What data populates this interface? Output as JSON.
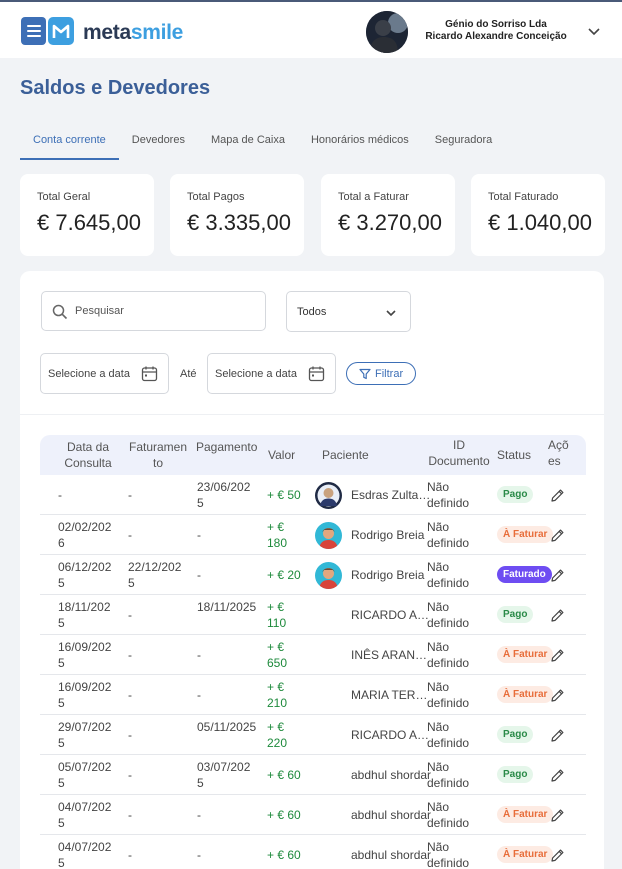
{
  "app": {
    "brand_a": "meta",
    "brand_b": "smile",
    "brand_color": "#3d6fb6",
    "accent_color": "#3d9fe0"
  },
  "user": {
    "company": "Génio do Sorriso Lda",
    "name": "Ricardo Alexandre Conceição",
    "avatar_icon": "user-avatar"
  },
  "page": {
    "title": "Saldos e Devedores"
  },
  "tabs": [
    {
      "label": "Conta corrente",
      "active": true
    },
    {
      "label": "Devedores",
      "active": false
    },
    {
      "label": "Mapa de Caixa",
      "active": false
    },
    {
      "label": "Honorários médicos",
      "active": false
    },
    {
      "label": "Seguradora",
      "active": false
    }
  ],
  "stats": [
    {
      "label": "Total Geral",
      "value": "€ 7.645,00"
    },
    {
      "label": "Total Pagos",
      "value": "€ 3.335,00"
    },
    {
      "label": "Total a Faturar",
      "value": "€ 3.270,00"
    },
    {
      "label": "Total Faturado",
      "value": "€ 1.040,00"
    }
  ],
  "filters": {
    "search_placeholder": "Pesquisar",
    "status_value": "Todos",
    "date_from_placeholder": "Selecione a data",
    "until_label": "Até",
    "date_to_placeholder": "Selecione a data",
    "filter_button": "Filtrar"
  },
  "table": {
    "headers": [
      "Data da Consulta",
      "Faturamento",
      "Pagamento",
      "Valor",
      "Paciente",
      "ID Documento",
      "Status",
      "Ações"
    ],
    "rows": [
      {
        "consulta": "-",
        "faturamento": "-",
        "pagamento": "23/06/2025",
        "valor": "+ € 50",
        "paciente": "Esdras Zultanski",
        "avatar": "dark",
        "documento": "Não definido",
        "status": "Pago"
      },
      {
        "consulta": "02/02/2026",
        "faturamento": "-",
        "pagamento": "-",
        "valor": "+ € 180",
        "paciente": "Rodrigo Breia",
        "avatar": "cyan",
        "documento": "Não definido",
        "status": "À Faturar"
      },
      {
        "consulta": "06/12/2025",
        "faturamento": "22/12/2025",
        "pagamento": "-",
        "valor": "+ € 20",
        "paciente": "Rodrigo Breia",
        "avatar": "cyan",
        "documento": "Não definido",
        "status": "Faturado"
      },
      {
        "consulta": "18/11/2025",
        "faturamento": "-",
        "pagamento": "18/11/2025",
        "valor": "+ € 110",
        "paciente": "RICARDO ALEXANDRE",
        "avatar": "",
        "documento": "Não definido",
        "status": "Pago"
      },
      {
        "consulta": "16/09/2025",
        "faturamento": "-",
        "pagamento": "-",
        "valor": "+ € 650",
        "paciente": "INÊS ARANTES HENRIQUES",
        "avatar": "",
        "documento": "Não definido",
        "status": "À Faturar"
      },
      {
        "consulta": "16/09/2025",
        "faturamento": "-",
        "pagamento": "-",
        "valor": "+ € 210",
        "paciente": "MARIA TERESA SANTOS",
        "avatar": "",
        "documento": "Não definido",
        "status": "À Faturar"
      },
      {
        "consulta": "29/07/2025",
        "faturamento": "-",
        "pagamento": "05/11/2025",
        "valor": "+ € 220",
        "paciente": "RICARDO ALEXANDRE",
        "avatar": "",
        "documento": "Não definido",
        "status": "Pago"
      },
      {
        "consulta": "05/07/2025",
        "faturamento": "-",
        "pagamento": "03/07/2025",
        "valor": "+ € 60",
        "paciente": "abdhul shordar",
        "avatar": "",
        "documento": "Não definido",
        "status": "Pago"
      },
      {
        "consulta": "04/07/2025",
        "faturamento": "-",
        "pagamento": "-",
        "valor": "+ € 60",
        "paciente": "abdhul shordar",
        "avatar": "",
        "documento": "Não definido",
        "status": "À Faturar"
      },
      {
        "consulta": "04/07/2025",
        "faturamento": "-",
        "pagamento": "-",
        "valor": "+ € 60",
        "paciente": "abdhul shordar",
        "avatar": "",
        "documento": "Não definido",
        "status": "À Faturar"
      }
    ]
  },
  "status_colors": {
    "Pago": "#2a8a48",
    "À Faturar": "#e86d3a",
    "Faturado": "#6e4df2"
  }
}
